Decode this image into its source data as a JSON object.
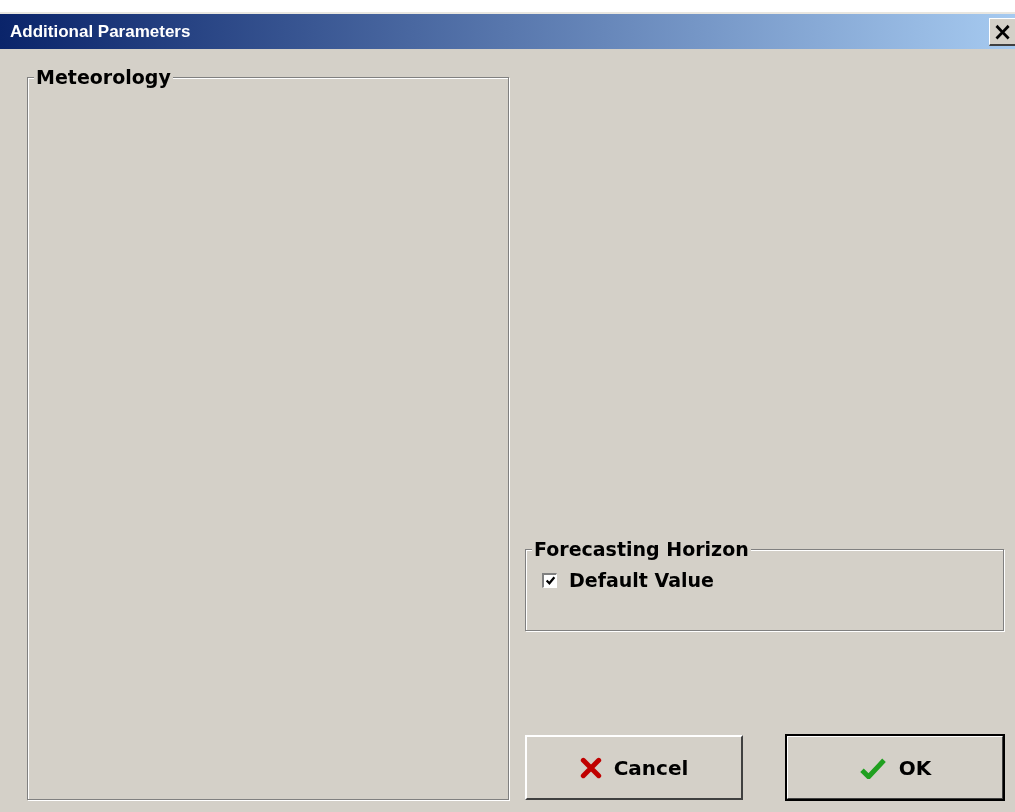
{
  "window": {
    "title": "Additional Parameters",
    "close": "×"
  },
  "meteorology": {
    "title": "Meteorology"
  },
  "forecasting_horizon": {
    "title": "Forecasting Horizon",
    "checkbox": {
      "label": "Default Value",
      "checked": true
    }
  },
  "buttons": [
    {
      "kind": "cancel",
      "label": "Cancel",
      "default": false
    },
    {
      "kind": "ok",
      "label": "OK",
      "default": true
    }
  ]
}
